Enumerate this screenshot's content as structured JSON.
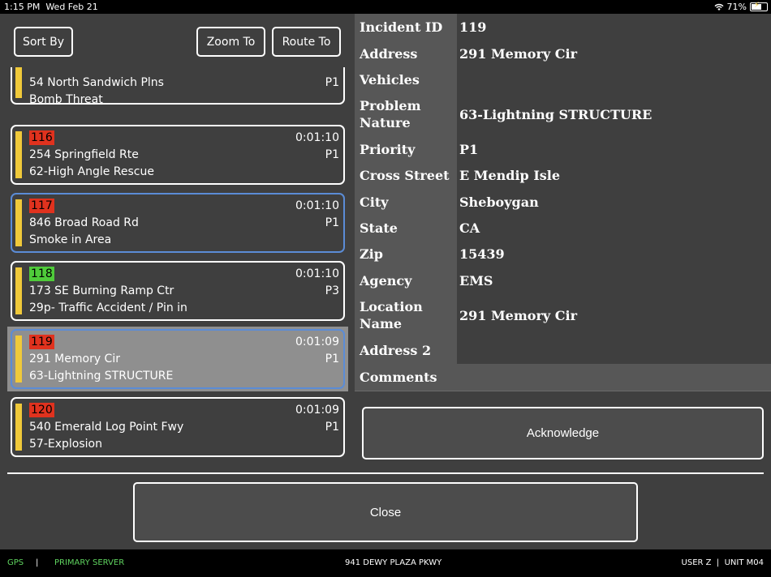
{
  "status_bar": {
    "time": "1:15 PM",
    "date": "Wed Feb 21",
    "battery": "71%",
    "battery_level": 0.71,
    "wifi_icon": "wifi-icon"
  },
  "toolbar": {
    "sort_label": "Sort By",
    "zoom_label": "Zoom To",
    "route_label": "Route To"
  },
  "incidents": [
    {
      "id": "",
      "time": "",
      "address": "54 North Sandwich Plns",
      "priority": "P1",
      "problem": "Bomb Threat",
      "badge_color": ""
    },
    {
      "id": "116",
      "time": "0:01:10",
      "address": "254 Springfield Rte",
      "priority": "P1",
      "problem": "62-High Angle Rescue",
      "badge_color": "#e0321e"
    },
    {
      "id": "117",
      "time": "0:01:10",
      "address": "846 Broad Road Rd",
      "priority": "P1",
      "problem": "Smoke in Area",
      "badge_color": "#e0321e"
    },
    {
      "id": "118",
      "time": "0:01:10",
      "address": "173 SE Burning Ramp Ctr",
      "priority": "P3",
      "problem": "29p- Traffic Accident / Pin in",
      "badge_color": "#4fcb3a"
    },
    {
      "id": "119",
      "time": "0:01:09",
      "address": "291 Memory Cir",
      "priority": "P1",
      "problem": "63-Lightning STRUCTURE",
      "badge_color": "#e0321e"
    },
    {
      "id": "120",
      "time": "0:01:09",
      "address": "540 Emerald Log Point Fwy",
      "priority": "P1",
      "problem": "57-Explosion",
      "badge_color": "#e0321e"
    }
  ],
  "details": [
    {
      "label": "Incident ID",
      "value": "119"
    },
    {
      "label": "Address",
      "value": "291 Memory Cir"
    },
    {
      "label": "Vehicles",
      "value": ""
    },
    {
      "label": "Problem Nature",
      "value": "63-Lightning STRUCTURE"
    },
    {
      "label": "Priority",
      "value": "P1"
    },
    {
      "label": "Cross Street",
      "value": "E Mendip Isle"
    },
    {
      "label": "City",
      "value": "Sheboygan"
    },
    {
      "label": "State",
      "value": "CA"
    },
    {
      "label": "Zip",
      "value": "15439"
    },
    {
      "label": "Agency",
      "value": "EMS"
    },
    {
      "label": "Location Name",
      "value": "291 Memory Cir"
    },
    {
      "label": "Address 2",
      "value": ""
    },
    {
      "label": "Comments",
      "value": ""
    }
  ],
  "comments_partial": "... ... ... ... ... ... ... ... ...",
  "acknowledge_label": "Acknowledge",
  "close_label": "Close",
  "footer": {
    "gps": "GPS",
    "separator": "|",
    "server": "PRIMARY SERVER",
    "location": "941 DEWY PLAZA PKWY",
    "user": "USER Z",
    "unit": "UNIT M04"
  },
  "colors": {
    "accent_selected": "#5b8cd6",
    "priority_bar": "#f0c93a",
    "status_green": "#5fd35f"
  }
}
